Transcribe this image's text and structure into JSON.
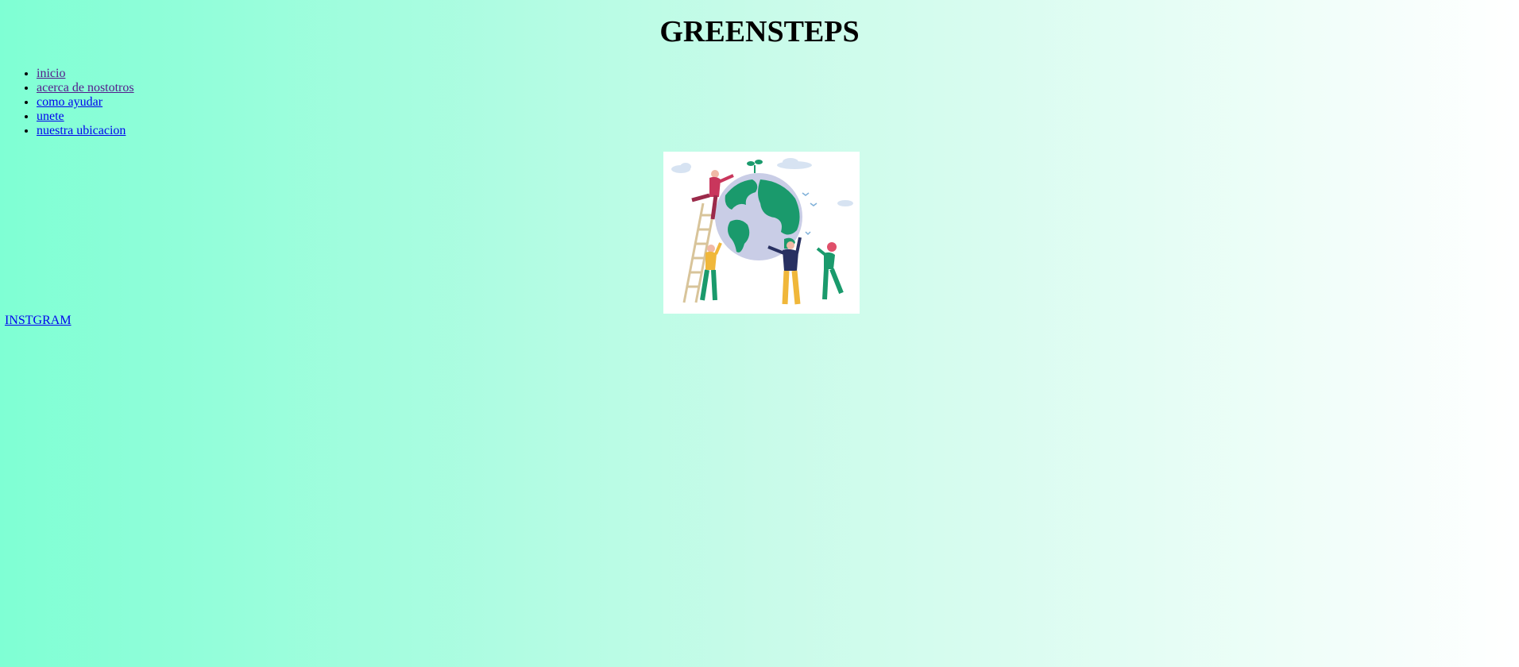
{
  "header": {
    "title": "GREENSTEPS"
  },
  "nav": {
    "items": [
      {
        "label": "inicio",
        "visited": true
      },
      {
        "label": "acerca de nostotros",
        "visited": true
      },
      {
        "label": "como ayudar",
        "visited": false
      },
      {
        "label": "unete",
        "visited": false
      },
      {
        "label": "nuestra ubicacion",
        "visited": false
      }
    ]
  },
  "hero": {
    "icon": "earth-volunteers-illustration"
  },
  "footer": {
    "instagram_label": "INSTGRAM"
  },
  "colors": {
    "gradient_start": "#7fffd4",
    "gradient_end": "#ffffff",
    "link": "#0000ee",
    "link_visited": "#551a8b",
    "earth_green": "#1a9a6c",
    "earth_blue": "#c9cde6"
  }
}
